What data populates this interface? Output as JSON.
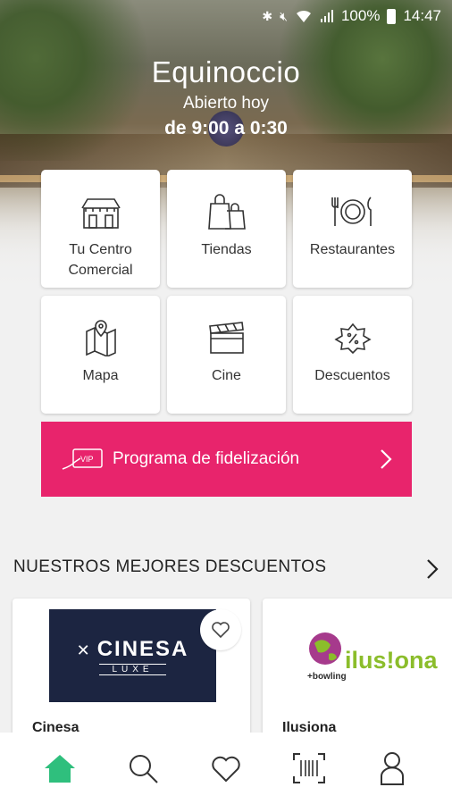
{
  "status_bar": {
    "battery": "100%",
    "time": "14:47"
  },
  "header": {
    "mall_name": "Equinoccio",
    "open_label": "Abierto hoy",
    "open_hours": "de 9:00 a 0:30"
  },
  "tiles": [
    {
      "label": "Tu Centro Comercial",
      "icon": "mall-building-icon"
    },
    {
      "label": "Tiendas",
      "icon": "shopping-bags-icon"
    },
    {
      "label": "Restaurantes",
      "icon": "plate-cutlery-icon"
    },
    {
      "label": "Mapa",
      "icon": "map-pin-icon"
    },
    {
      "label": "Cine",
      "icon": "clapperboard-icon"
    },
    {
      "label": "Descuentos",
      "icon": "discount-badge-icon"
    }
  ],
  "loyalty": {
    "label": "Programa de fidelización",
    "icon_text": "VIP"
  },
  "discounts": {
    "title": "NUESTROS MEJORES DESCUENTOS",
    "cards": [
      {
        "name": "Cinesa",
        "logo_text": "CINESA",
        "logo_sub": "LUXE"
      },
      {
        "name": "Ilusiona",
        "logo_text": "ilus!ona",
        "logo_tag": "+bowling"
      }
    ]
  },
  "bottom_nav": [
    "home-icon",
    "search-icon",
    "heart-icon",
    "barcode-scan-icon",
    "profile-icon"
  ],
  "colors": {
    "accent_pink": "#e8246c",
    "home_active": "#2fbf7d",
    "cinesa_navy": "#1c2541"
  }
}
